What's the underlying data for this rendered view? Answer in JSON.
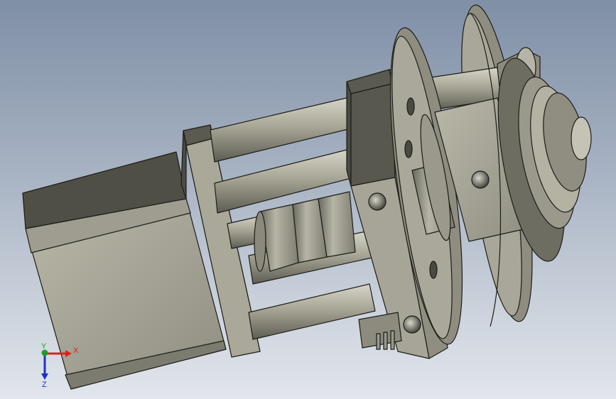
{
  "triad": {
    "x_label": "X",
    "y_label": "Y",
    "z_label": "Z",
    "x_color": "#e0201c",
    "y_color": "#1aa12a",
    "z_color": "#2030c8"
  },
  "model": {
    "body_color": "#aaa99a",
    "shade_color": "#6f6e63",
    "dark_color": "#4e4e45",
    "edge_color": "#1c1c18"
  }
}
